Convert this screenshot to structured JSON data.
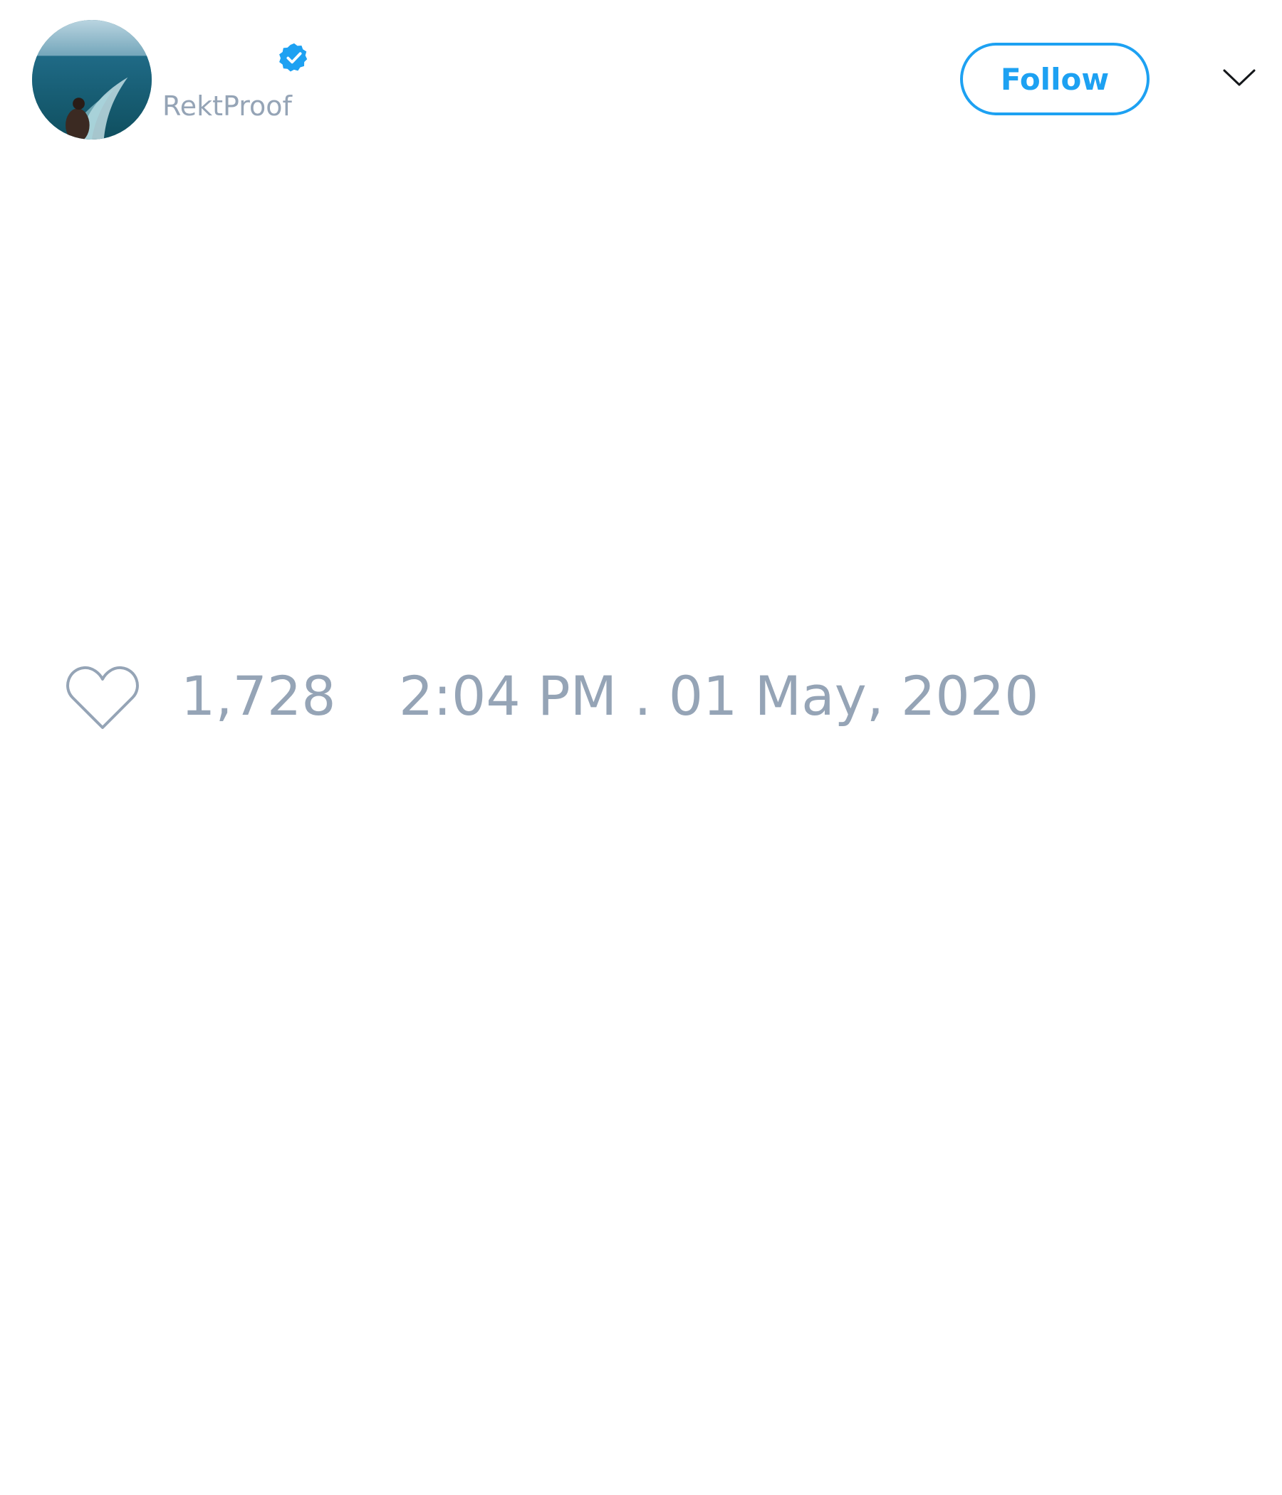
{
  "tweet": {
    "author": {
      "handle": "RektProof",
      "verified": true,
      "avatar": "ocean-photo-avatar"
    },
    "follow_label": "Follow",
    "like_count": "1,728",
    "timestamp": "2:04 PM . 01 May, 2020"
  },
  "icons": {
    "verified": "verified-badge-icon",
    "menu": "chevron-down-icon",
    "like": "heart-outline-icon"
  },
  "colors": {
    "accent": "#1da1f2",
    "muted_text": "#95a4b6",
    "background": "#ffffff"
  }
}
